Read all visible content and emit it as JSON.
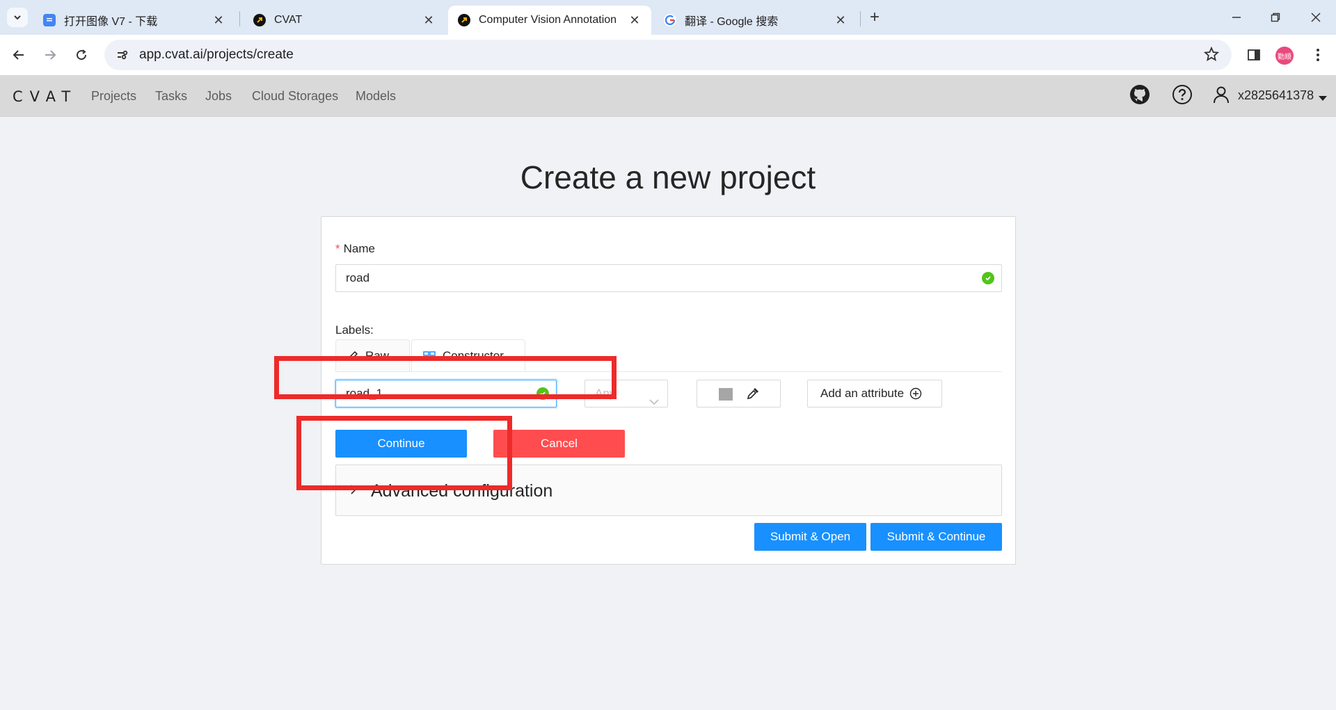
{
  "browser": {
    "tabs": [
      {
        "title": "打开图像 V7 - 下载",
        "favicon": "google-docs-icon",
        "active": false
      },
      {
        "title": "CVAT",
        "favicon": "cvat-icon",
        "active": false
      },
      {
        "title": "Computer Vision Annotation",
        "favicon": "cvat-icon",
        "active": true
      },
      {
        "title": "翻译 - Google 搜索",
        "favicon": "google-icon",
        "active": false
      }
    ],
    "url": "app.cvat.ai/projects/create",
    "profile_initials": "勤顺"
  },
  "header": {
    "logo": "CVAT",
    "menu": [
      "Projects",
      "Tasks",
      "Jobs",
      "Cloud Storages",
      "Models"
    ],
    "username": "x2825641378"
  },
  "page": {
    "title": "Create a new project",
    "name_label": "Name",
    "name_required_mark": "*",
    "name_value": "road",
    "labels_caption": "Labels:",
    "label_tabs": [
      "Raw",
      "Constructor"
    ],
    "new_label_value": "road_1",
    "type_select_value": "Any",
    "add_attribute_label": "Add an attribute",
    "continue_label": "Continue",
    "cancel_label": "Cancel",
    "advanced_label": "Advanced configuration",
    "submit_open_label": "Submit & Open",
    "submit_continue_label": "Submit & Continue"
  },
  "colors": {
    "primary": "#1890ff",
    "danger": "#ff4d4f",
    "success": "#52c41a",
    "annotation": "#ee2a2a",
    "label_color": "#a6a6a6"
  }
}
